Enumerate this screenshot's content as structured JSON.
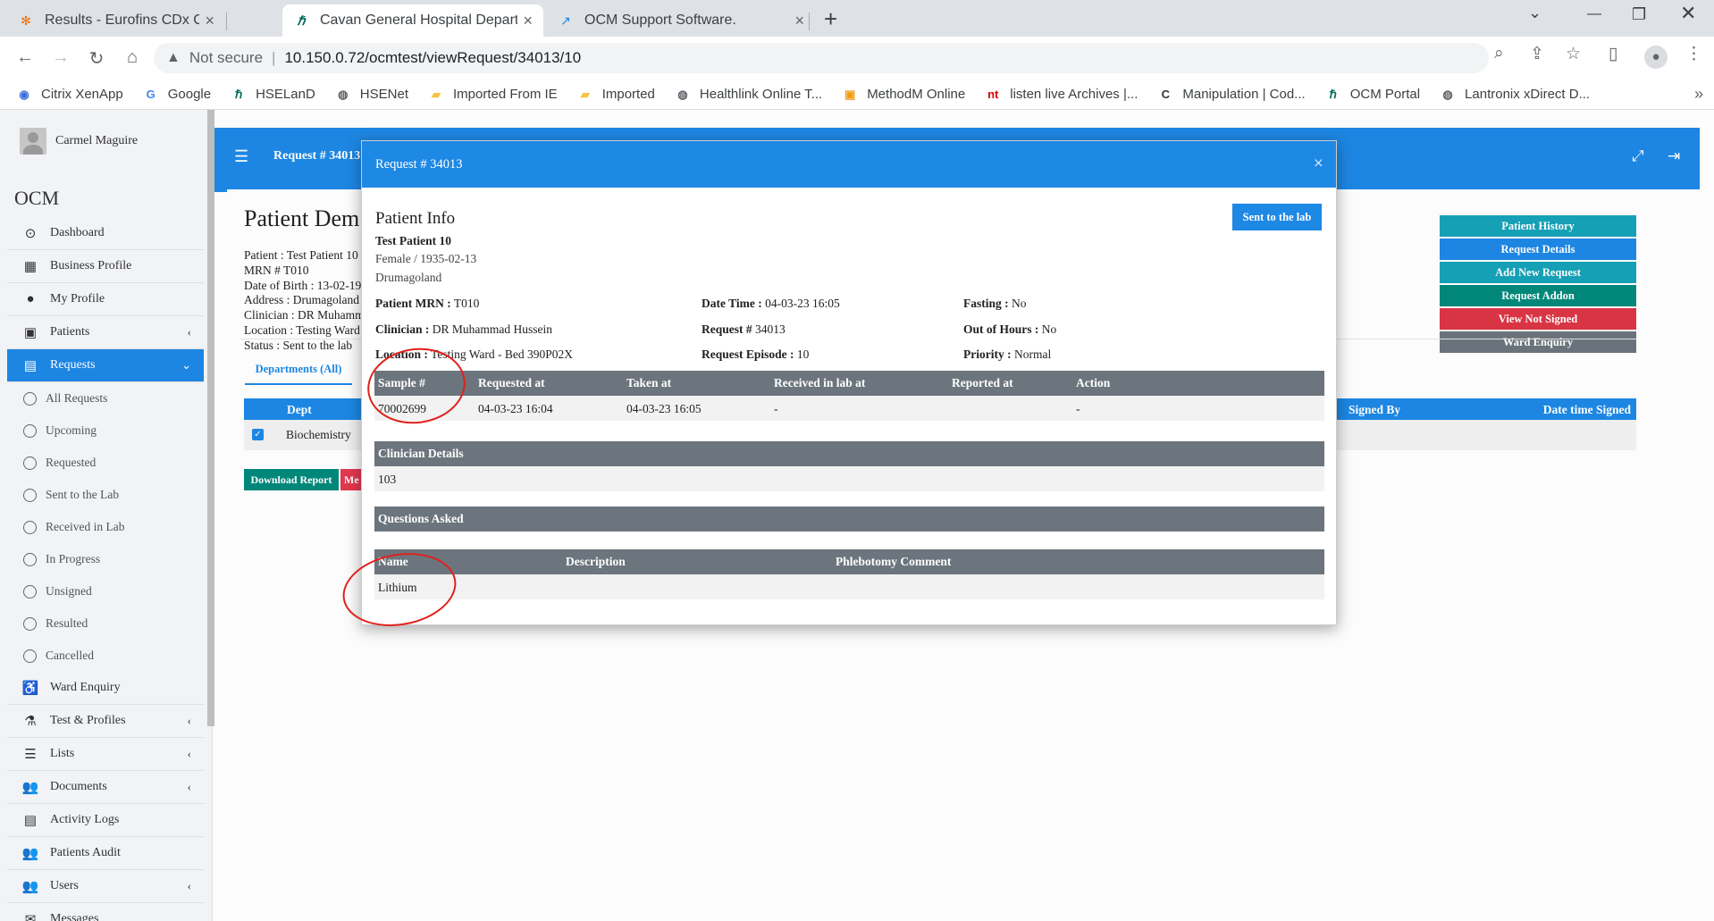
{
  "browser": {
    "tabs": [
      {
        "title": "Results - Eurofins CDx Connect",
        "icon": "eurofins-icon",
        "active": false
      },
      {
        "title": "Cavan General Hospital Departm",
        "icon": "hse-icon",
        "active": true
      },
      {
        "title": "OCM Support Software.",
        "icon": "ocm-support-icon",
        "active": false
      }
    ],
    "new_tab": "+",
    "address": {
      "warning": "Not secure",
      "url": "10.150.0.72/ocmtest/viewRequest/34013/10"
    },
    "bookmarks": [
      {
        "label": "Citrix XenApp",
        "icon": "citrix-icon"
      },
      {
        "label": "Google",
        "icon": "google-icon"
      },
      {
        "label": "HSELanD",
        "icon": "hse-icon"
      },
      {
        "label": "HSENet",
        "icon": "globe-icon"
      },
      {
        "label": "Imported From IE",
        "icon": "folder-icon"
      },
      {
        "label": "Imported",
        "icon": "folder-icon"
      },
      {
        "label": "Healthlink Online T...",
        "icon": "globe-icon"
      },
      {
        "label": "MethodM Online",
        "icon": "methodm-icon"
      },
      {
        "label": "listen live Archives |...",
        "icon": "nt-icon"
      },
      {
        "label": "Manipulation | Cod...",
        "icon": "c-icon"
      },
      {
        "label": "OCM Portal",
        "icon": "hse-icon"
      },
      {
        "label": "Lantronix xDirect D...",
        "icon": "globe-icon"
      }
    ],
    "bookmarks_more": "»"
  },
  "sidebar": {
    "user": "Carmel Maguire",
    "brand": "OCM",
    "menu": [
      {
        "label": "Dashboard",
        "icon": "dashboard-icon",
        "glyph": "⊙",
        "arrow": ""
      },
      {
        "label": "Business Profile",
        "icon": "building-icon",
        "glyph": "▦",
        "arrow": ""
      },
      {
        "label": "My Profile",
        "icon": "user-icon",
        "glyph": "●",
        "arrow": ""
      },
      {
        "label": "Patients",
        "icon": "hospital-icon",
        "glyph": "▣",
        "arrow": "‹"
      },
      {
        "label": "Requests",
        "icon": "file-icon",
        "glyph": "▤",
        "arrow": "⌄",
        "active": true
      }
    ],
    "submenu": [
      "All Requests",
      "Upcoming",
      "Requested",
      "Sent to the Lab",
      "Received in Lab",
      "In Progress",
      "Unsigned",
      "Resulted",
      "Cancelled"
    ],
    "menu2": [
      {
        "label": "Ward Enquiry",
        "icon": "wheelchair-icon",
        "glyph": "♿",
        "arrow": ""
      },
      {
        "label": "Test & Profiles",
        "icon": "test-tube-icon",
        "glyph": "⚗",
        "arrow": "‹"
      },
      {
        "label": "Lists",
        "icon": "list-icon",
        "glyph": "☰",
        "arrow": "‹"
      },
      {
        "label": "Documents",
        "icon": "users-icon",
        "glyph": "👥",
        "arrow": "‹"
      },
      {
        "label": "Activity Logs",
        "icon": "log-icon",
        "glyph": "▤",
        "arrow": ""
      },
      {
        "label": "Patients Audit",
        "icon": "users-icon",
        "glyph": "👥",
        "arrow": ""
      },
      {
        "label": "Users",
        "icon": "users-icon",
        "glyph": "👥",
        "arrow": "‹"
      },
      {
        "label": "Messages",
        "icon": "envelope-icon",
        "glyph": "✉",
        "arrow": ""
      }
    ]
  },
  "topnav": {
    "title": "Request # 34013"
  },
  "patient_page": {
    "title": "Patient Dem",
    "lines": [
      "Patient : Test Patient 10",
      "MRN # T010",
      "Date of Birth : 13-02-19",
      "Address : Drumagoland",
      "Clinician : DR Muhamm",
      "Location : Testing Ward",
      "Status : Sent to the lab"
    ],
    "buttons": [
      {
        "label": "Patient History",
        "color": "#17a2b8"
      },
      {
        "label": "Request Details",
        "color": "#1e88e5"
      },
      {
        "label": "Add New Request",
        "color": "#17a2b8"
      },
      {
        "label": "Request Addon",
        "color": "#00897b"
      },
      {
        "label": "View Not Signed",
        "color": "#dc3545"
      },
      {
        "label": "Ward Enquiry",
        "color": "#6c757d"
      }
    ],
    "dept_tab": "Departments (All)",
    "dept_table": {
      "headers": {
        "dept": "Dept",
        "signed_by": "Signed By",
        "date_signed": "Date time Signed"
      },
      "row": {
        "dept": "Biochemistry"
      }
    },
    "download_button": "Download Report",
    "message_button": "Me"
  },
  "modal": {
    "title": "Request # 34013",
    "close": "×",
    "section_title": "Patient Info",
    "patient_name": "Test Patient 10",
    "gender_dob": "Female / 1935-02-13",
    "address": "Drumagoland",
    "sent_button": "Sent to the lab",
    "info": {
      "mrn_label": "Patient MRN :",
      "mrn": "T010",
      "datetime_label": "Date Time :",
      "datetime": "04-03-23 16:05",
      "fasting_label": "Fasting :",
      "fasting": "No",
      "clinician_label": "Clinician :",
      "clinician": "DR Muhammad Hussein",
      "request_label": "Request #",
      "request": "34013",
      "ooh_label": "Out of Hours :",
      "ooh": "No",
      "location_label": "Location :",
      "location": "Testing Ward - Bed 390P02X",
      "episode_label": "Request Episode :",
      "episode": "10",
      "priority_label": "Priority :",
      "priority": "Normal"
    },
    "samples": {
      "headers": [
        "Sample #",
        "Requested at",
        "Taken at",
        "Received in lab at",
        "Reported at",
        "Action"
      ],
      "row": [
        "70002699",
        "04-03-23 16:04",
        "04-03-23 16:05",
        "-",
        "",
        "-"
      ]
    },
    "clinician_details": {
      "header": "Clinician Details",
      "value": "103"
    },
    "questions": {
      "header": "Questions Asked"
    },
    "tests": {
      "headers": [
        "Name",
        "Description",
        "Phlebotomy Comment"
      ],
      "row": [
        "Lithium",
        "",
        ""
      ]
    }
  },
  "annotation_color": "#e0201b"
}
